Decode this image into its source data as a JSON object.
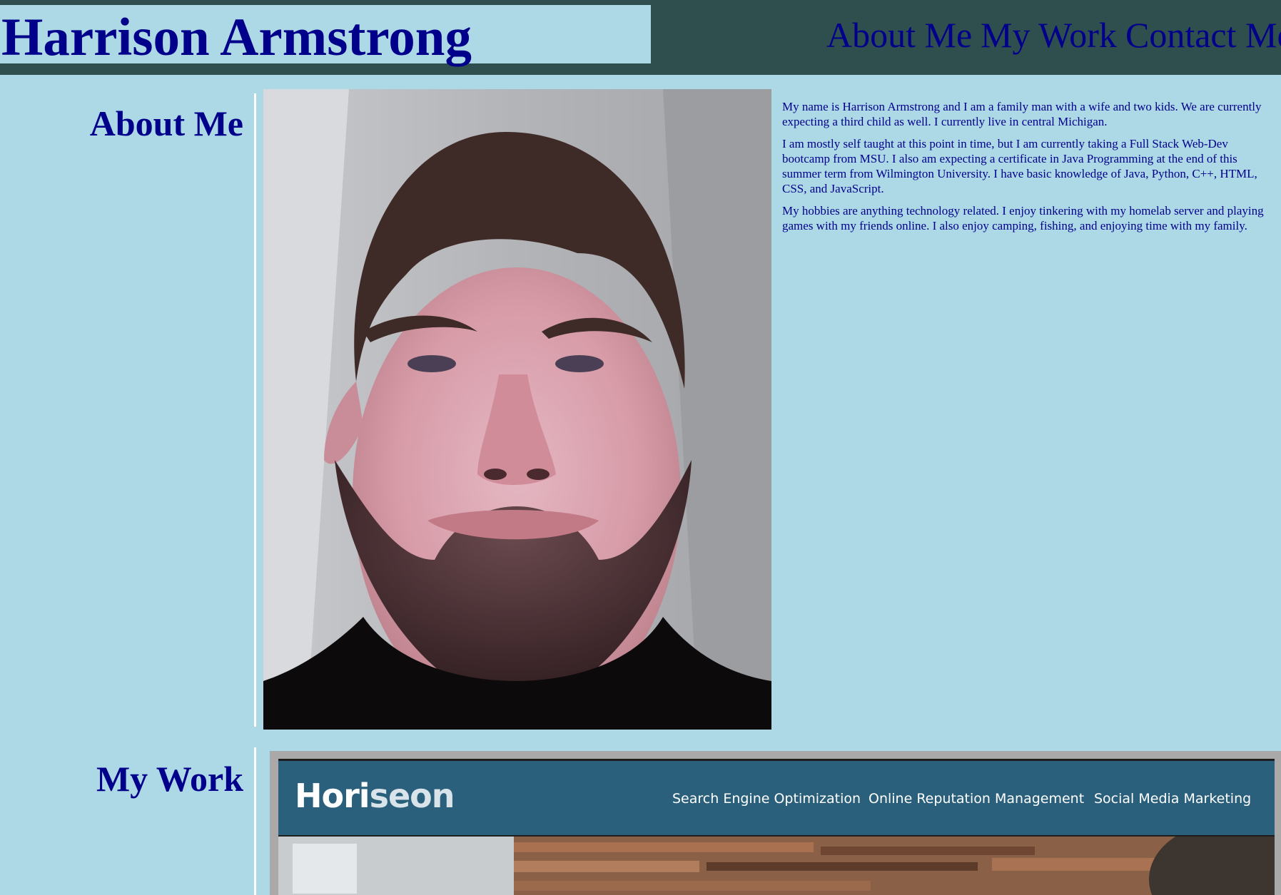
{
  "header": {
    "title": "Harrison Armstrong",
    "nav": [
      "About Me",
      "My Work",
      "Contact Me"
    ]
  },
  "about": {
    "heading": "About Me",
    "paragraphs": [
      "My name is Harrison Armstrong and I am a family man with a wife and two kids. We are currently expecting a third child as well. I currently live in central Michigan.",
      "I am mostly self taught at this point in time, but I am currently taking a Full Stack Web-Dev bootcamp from MSU. I also am expecting a certificate in Java Programming at the end of this summer term from Wilmington University. I have basic knowledge of Java, Python, C++, HTML, CSS, and JavaScript.",
      "My hobbies are anything technology related. I enjoy tinkering with my homelab server and playing games with my friends online. I also enjoy camping, fishing, and enjoying time with my family."
    ]
  },
  "work": {
    "heading": "My Work",
    "preview": {
      "logo_main": "Hori",
      "logo_accent": "seon",
      "nav": [
        "Search Engine Optimization",
        "Online Reputation Management",
        "Social Media Marketing"
      ]
    }
  },
  "colors": {
    "page_bg": "#add8e6",
    "header_bg": "#2f4f4f",
    "text": "#00008b",
    "preview_header": "#2a607c"
  }
}
